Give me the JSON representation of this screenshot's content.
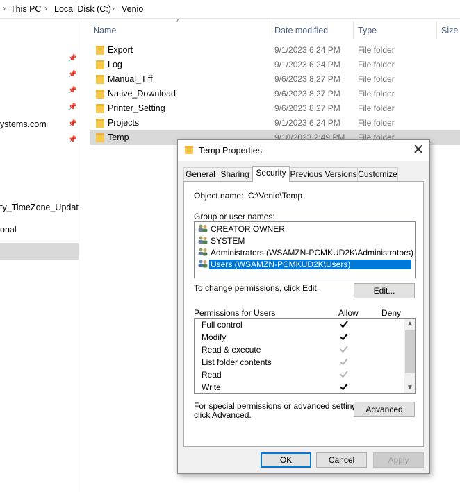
{
  "breadcrumb": [
    "This PC",
    "Local Disk (C:)",
    "Venio"
  ],
  "nav": {
    "items": [
      "ystems.com",
      "ty_TimeZone_Update_",
      "onal"
    ]
  },
  "columns": {
    "name": "Name",
    "date": "Date modified",
    "type": "Type",
    "size": "Size"
  },
  "files": [
    {
      "name": "Export",
      "date": "9/1/2023 6:24 PM",
      "type": "File folder"
    },
    {
      "name": "Log",
      "date": "9/1/2023 6:24 PM",
      "type": "File folder"
    },
    {
      "name": "Manual_Tiff",
      "date": "9/6/2023 8:27 PM",
      "type": "File folder"
    },
    {
      "name": "Native_Download",
      "date": "9/6/2023 8:27 PM",
      "type": "File folder"
    },
    {
      "name": "Printer_Setting",
      "date": "9/6/2023 8:27 PM",
      "type": "File folder"
    },
    {
      "name": "Projects",
      "date": "9/1/2023 6:24 PM",
      "type": "File folder"
    },
    {
      "name": "Temp",
      "date": "9/18/2023 2:49 PM",
      "type": "File folder"
    }
  ],
  "dialog": {
    "title": "Temp Properties",
    "close_icon": "close-icon",
    "tabs": [
      "General",
      "Sharing",
      "Security",
      "Previous Versions",
      "Customize"
    ],
    "active_tab": "Security",
    "object_label": "Object name:",
    "object_value": "C:\\Venio\\Temp",
    "group_label": "Group or user names:",
    "users": [
      "CREATOR OWNER",
      "SYSTEM",
      "Administrators (WSAMZN-PCMKUD2K\\Administrators)",
      "Users (WSAMZN-PCMKUD2K\\Users)"
    ],
    "selected_user": "Users (WSAMZN-PCMKUD2K\\Users)",
    "change_text": "To change permissions, click Edit.",
    "edit_button": "Edit...",
    "perm_label": "Permissions for Users",
    "allow_label": "Allow",
    "deny_label": "Deny",
    "permissions": [
      {
        "name": "Full control",
        "allow": "check"
      },
      {
        "name": "Modify",
        "allow": "check"
      },
      {
        "name": "Read & execute",
        "allow": "check-grey"
      },
      {
        "name": "List folder contents",
        "allow": "check-grey"
      },
      {
        "name": "Read",
        "allow": "check-grey"
      },
      {
        "name": "Write",
        "allow": "check"
      }
    ],
    "special_text_1": "For special permissions or advanced settings,",
    "special_text_2": "click Advanced.",
    "advanced_button": "Advanced",
    "ok_button": "OK",
    "cancel_button": "Cancel",
    "apply_button": "Apply"
  },
  "colors": {
    "selection": "#0078d7",
    "row_selected": "#d9d9d9",
    "folder": "#f4c94e",
    "header_text": "#4d6082"
  }
}
